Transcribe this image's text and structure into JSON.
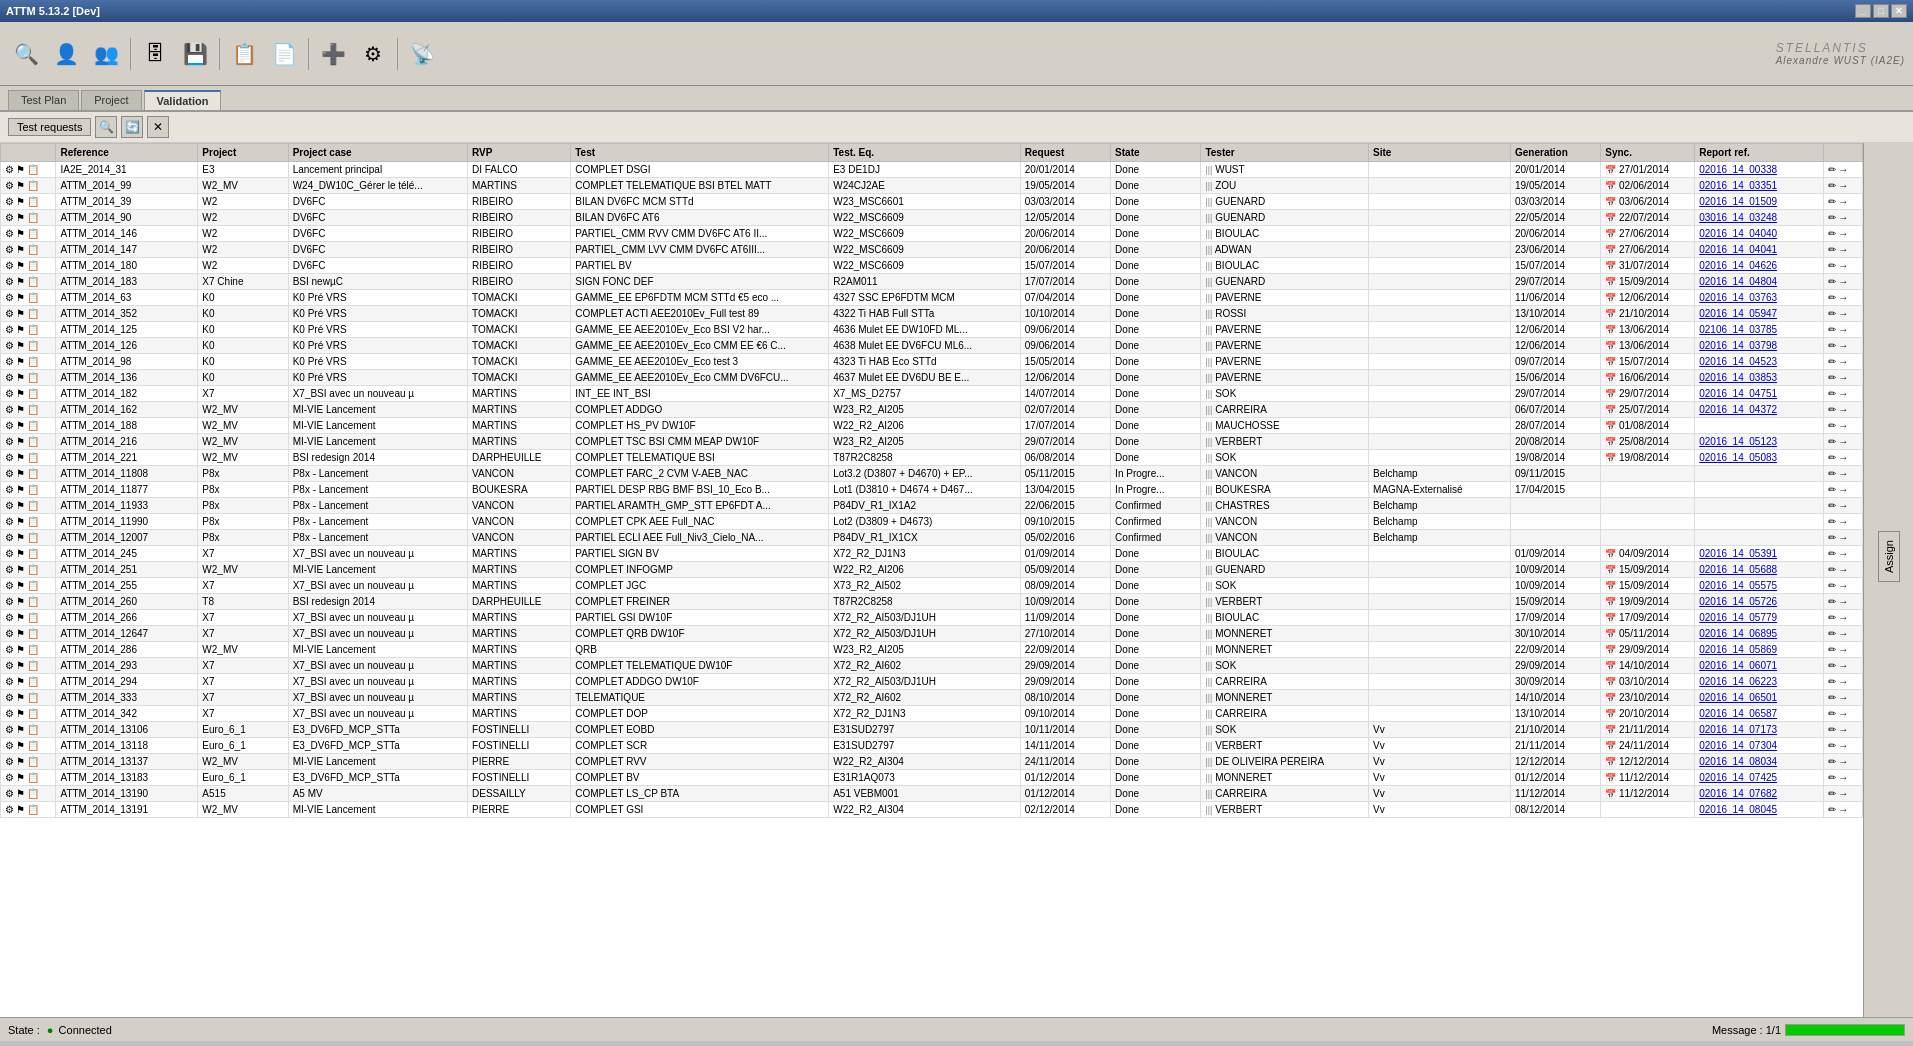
{
  "titleBar": {
    "title": "ATTM 5.13.2 [Dev]",
    "controls": [
      "_",
      "□",
      "✕"
    ]
  },
  "brand": "STELLANTIS",
  "userInfo": "Alexandre WUST (IA2E)",
  "tabs": [
    {
      "label": "Test Plan",
      "active": false
    },
    {
      "label": "Project",
      "active": false
    },
    {
      "label": "Validation",
      "active": true
    }
  ],
  "subToolbar": {
    "testRequestsBtn": "Test requests",
    "icons": [
      "🔍",
      "🔄",
      "✕"
    ]
  },
  "tableHeaders": [
    "Reference",
    "Project",
    "Project case",
    "RVP",
    "Test",
    "Test. Eq.",
    "Request",
    "State",
    "Tester",
    "Site",
    "Generation",
    "Sync.",
    "Report ref."
  ],
  "rows": [
    {
      "ref": "IA2E_2014_31",
      "icons": "⚙📋",
      "project": "E3",
      "case": "Lancement principal",
      "rvp": "DI FALCO",
      "test": "COMPLET DSGI",
      "testeq": "E3 DE1DJ",
      "request": "20/01/2014",
      "state": "Done",
      "tester": "WUST",
      "site": "",
      "gen": "20/01/2014",
      "sync": "27/01/2014",
      "report": "02016_14_00338"
    },
    {
      "ref": "ATTM_2014_99",
      "icons": "⚙📋",
      "project": "W2_MV",
      "case": "W24_DW10C_Gérer le télé...",
      "rvp": "MARTINS",
      "test": "COMPLET TELEMATIQUE BSI BTEL MATT",
      "testeq": "W24CJ2AE",
      "request": "19/05/2014",
      "state": "Done",
      "tester": "ZOU",
      "site": "",
      "gen": "19/05/2014",
      "sync": "02/06/2014",
      "report": "02016_14_03351"
    },
    {
      "ref": "ATTM_2014_39",
      "icons": "⚙📋",
      "project": "W2",
      "case": "DV6FC",
      "rvp": "RIBEIRO",
      "test": "BILAN DV6FC MCM STTd",
      "testeq": "W23_MSC6601",
      "request": "03/03/2014",
      "state": "Done",
      "tester": "GUENARD",
      "site": "",
      "gen": "03/03/2014",
      "sync": "03/06/2014",
      "report": "02016_14_01509"
    },
    {
      "ref": "ATTM_2014_90",
      "icons": "⚙📋",
      "project": "W2",
      "case": "DV6FC",
      "rvp": "RIBEIRO",
      "test": "BILAN DV6FC AT6",
      "testeq": "W22_MSC6609",
      "request": "12/05/2014",
      "state": "Done",
      "tester": "GUENARD",
      "site": "",
      "gen": "22/05/2014",
      "sync": "22/07/2014",
      "report": "03016_14_03248"
    },
    {
      "ref": "ATTM_2014_146",
      "icons": "⚙📋",
      "project": "W2",
      "case": "DV6FC",
      "rvp": "RIBEIRO",
      "test": "PARTIEL_CMM RVV CMM DV6FC AT6 II...",
      "testeq": "W22_MSC6609",
      "request": "20/06/2014",
      "state": "Done",
      "tester": "BIOULAC",
      "site": "",
      "gen": "20/06/2014",
      "sync": "27/06/2014",
      "report": "02016_14_04040"
    },
    {
      "ref": "ATTM_2014_147",
      "icons": "⚙📋",
      "project": "W2",
      "case": "DV6FC",
      "rvp": "RIBEIRO",
      "test": "PARTIEL_CMM LVV CMM DV6FC AT6III...",
      "testeq": "W22_MSC6609",
      "request": "20/06/2014",
      "state": "Done",
      "tester": "ADWAN",
      "site": "",
      "gen": "23/06/2014",
      "sync": "27/06/2014",
      "report": "02016_14_04041"
    },
    {
      "ref": "ATTM_2014_180",
      "icons": "⚙📋",
      "project": "W2",
      "case": "DV6FC",
      "rvp": "RIBEIRO",
      "test": "PARTIEL BV",
      "testeq": "W22_MSC6609",
      "request": "15/07/2014",
      "state": "Done",
      "tester": "BIOULAC",
      "site": "",
      "gen": "15/07/2014",
      "sync": "31/07/2014",
      "report": "02016_14_04626"
    },
    {
      "ref": "ATTM_2014_183",
      "icons": "⚙📋",
      "project": "X7 Chine",
      "case": "BSI newµC",
      "rvp": "RIBEIRO",
      "test": "SIGN FONC DEF",
      "testeq": "R2AM011",
      "request": "17/07/2014",
      "state": "Done",
      "tester": "GUENARD",
      "site": "",
      "gen": "29/07/2014",
      "sync": "15/09/2014",
      "report": "02016_14_04804"
    },
    {
      "ref": "ATTM_2014_63",
      "icons": "⚙📋",
      "project": "K0",
      "case": "K0 Pré VRS",
      "rvp": "TOMACKI",
      "test": "GAMME_EE EP6FDTM MCM STTd €5 eco ...",
      "testeq": "4327 SSC EP6FDTM MCM",
      "request": "07/04/2014",
      "state": "Done",
      "tester": "PAVERNE",
      "site": "",
      "gen": "11/06/2014",
      "sync": "12/06/2014",
      "report": "02016_14_03763"
    },
    {
      "ref": "ATTM_2014_352",
      "icons": "⚙📋",
      "project": "K0",
      "case": "K0 Pré VRS",
      "rvp": "TOMACKI",
      "test": "COMPLET ACTI AEE2010Ev_Full test 89",
      "testeq": "4322 Ti HAB Full STTa",
      "request": "10/10/2014",
      "state": "Done",
      "tester": "ROSSI",
      "site": "",
      "gen": "13/10/2014",
      "sync": "21/10/2014",
      "report": "02016_14_05947"
    },
    {
      "ref": "ATTM_2014_125",
      "icons": "⚙📋",
      "project": "K0",
      "case": "K0 Pré VRS",
      "rvp": "TOMACKI",
      "test": "GAMME_EE AEE2010Ev_Eco BSI V2 har...",
      "testeq": "4636 Mulet EE DW10FD ML...",
      "request": "09/06/2014",
      "state": "Done",
      "tester": "PAVERNE",
      "site": "",
      "gen": "12/06/2014",
      "sync": "13/06/2014",
      "report": "02106_14_03785"
    },
    {
      "ref": "ATTM_2014_126",
      "icons": "⚙📋",
      "project": "K0",
      "case": "K0 Pré VRS",
      "rvp": "TOMACKI",
      "test": "GAMME_EE AEE2010Ev_Eco CMM EE €6 C...",
      "testeq": "4638 Mulet EE DV6FCU ML6...",
      "request": "09/06/2014",
      "state": "Done",
      "tester": "PAVERNE",
      "site": "",
      "gen": "12/06/2014",
      "sync": "13/06/2014",
      "report": "02016_14_03798"
    },
    {
      "ref": "ATTM_2014_98",
      "icons": "⚙📋",
      "project": "K0",
      "case": "K0 Pré VRS",
      "rvp": "TOMACKI",
      "test": "GAMME_EE AEE2010Ev_Eco test 3",
      "testeq": "4323 Ti HAB Eco STTd",
      "request": "15/05/2014",
      "state": "Done",
      "tester": "PAVERNE",
      "site": "",
      "gen": "09/07/2014",
      "sync": "15/07/2014",
      "report": "02016_14_04523"
    },
    {
      "ref": "ATTM_2014_136",
      "icons": "⚙📋",
      "project": "K0",
      "case": "K0 Pré VRS",
      "rvp": "TOMACKI",
      "test": "GAMME_EE AEE2010Ev_Eco CMM DV6FCU...",
      "testeq": "4637 Mulet EE DV6DU BE E...",
      "request": "12/06/2014",
      "state": "Done",
      "tester": "PAVERNE",
      "site": "",
      "gen": "15/06/2014",
      "sync": "16/06/2014",
      "report": "02016_14_03853"
    },
    {
      "ref": "ATTM_2014_182",
      "icons": "⚙📋",
      "project": "X7",
      "case": "X7_BSI avec un nouveau µ",
      "rvp": "MARTINS",
      "test": "INT_EE INT_BSI",
      "testeq": "X7_MS_D2757",
      "request": "14/07/2014",
      "state": "Done",
      "tester": "SOK",
      "site": "",
      "gen": "29/07/2014",
      "sync": "29/07/2014",
      "report": "02016_14_04751"
    },
    {
      "ref": "ATTM_2014_162",
      "icons": "⚙📋",
      "project": "W2_MV",
      "case": "MI-VIE Lancement",
      "rvp": "MARTINS",
      "test": "COMPLET ADDGO",
      "testeq": "W23_R2_AI205",
      "request": "02/07/2014",
      "state": "Done",
      "tester": "CARREIRA",
      "site": "",
      "gen": "06/07/2014",
      "sync": "25/07/2014",
      "report": "02016_14_04372"
    },
    {
      "ref": "ATTM_2014_188",
      "icons": "⚙📋",
      "project": "W2_MV",
      "case": "MI-VIE Lancement",
      "rvp": "MARTINS",
      "test": "COMPLET HS_PV DW10F",
      "testeq": "W22_R2_AI206",
      "request": "17/07/2014",
      "state": "Done",
      "tester": "MAUCHOSSE",
      "site": "",
      "gen": "28/07/2014",
      "sync": "01/08/2014",
      "report": ""
    },
    {
      "ref": "ATTM_2014_216",
      "icons": "⚙📋",
      "project": "W2_MV",
      "case": "MI-VIE Lancement",
      "rvp": "MARTINS",
      "test": "COMPLET TSC BSI CMM MEAP DW10F",
      "testeq": "W23_R2_AI205",
      "request": "29/07/2014",
      "state": "Done",
      "tester": "VERBERT",
      "site": "",
      "gen": "20/08/2014",
      "sync": "25/08/2014",
      "report": "02016_14_05123"
    },
    {
      "ref": "ATTM_2014_221",
      "icons": "⚙📋",
      "project": "W2_MV",
      "case": "BSI redesign 2014",
      "rvp": "DARPHEUILLE",
      "test": "COMPLET TELEMATIQUE BSI",
      "testeq": "T87R2C8258",
      "request": "06/08/2014",
      "state": "Done",
      "tester": "SOK",
      "site": "",
      "gen": "19/08/2014",
      "sync": "19/08/2014",
      "report": "02016_14_05083"
    },
    {
      "ref": "ATTM_2014_11808",
      "icons": "⚙📋",
      "project": "P8x",
      "case": "P8x - Lancement",
      "rvp": "VANCON",
      "test": "COMPLET FARC_2 CVM V-AEB_NAC",
      "testeq": "Lot3.2 (D3807 + D4670) + EP...",
      "request": "05/11/2015",
      "state": "In Progre...",
      "tester": "VANCON",
      "site": "Belchamp",
      "gen": "09/11/2015",
      "sync": "",
      "report": ""
    },
    {
      "ref": "ATTM_2014_11877",
      "icons": "⚙📋",
      "project": "P8x",
      "case": "P8x - Lancement",
      "rvp": "BOUKESRA",
      "test": "PARTIEL DESP RBG BMF BSI_10_Eco B...",
      "testeq": "Lot1 (D3810 + D4674 + D467...",
      "request": "13/04/2015",
      "state": "In Progre...",
      "tester": "BOUKESRA",
      "site": "MAGNA-Externalisé",
      "gen": "17/04/2015",
      "sync": "",
      "report": ""
    },
    {
      "ref": "ATTM_2014_11933",
      "icons": "⚙📋",
      "project": "P8x",
      "case": "P8x - Lancement",
      "rvp": "VANCON",
      "test": "PARTIEL ARAMTH_GMP_STT EP6FDT A...",
      "testeq": "P84DV_R1_IX1A2",
      "request": "22/06/2015",
      "state": "Confirmed",
      "tester": "CHASTRES",
      "site": "Belchamp",
      "gen": "",
      "sync": "",
      "report": ""
    },
    {
      "ref": "ATTM_2014_11990",
      "icons": "⚙📋",
      "project": "P8x",
      "case": "P8x - Lancement",
      "rvp": "VANCON",
      "test": "COMPLET CPK AEE Full_NAC",
      "testeq": "Lot2 (D3809 + D4673)",
      "request": "09/10/2015",
      "state": "Confirmed",
      "tester": "VANCON",
      "site": "Belchamp",
      "gen": "",
      "sync": "",
      "report": ""
    },
    {
      "ref": "ATTM_2014_12007",
      "icons": "⚙📋",
      "project": "P8x",
      "case": "P8x - Lancement",
      "rvp": "VANCON",
      "test": "PARTIEL ECLI AEE Full_Niv3_Cielo_NA...",
      "testeq": "P84DV_R1_IX1CX",
      "request": "05/02/2016",
      "state": "Confirmed",
      "tester": "VANCON",
      "site": "Belchamp",
      "gen": "",
      "sync": "",
      "report": ""
    },
    {
      "ref": "ATTM_2014_245",
      "icons": "⚙📋",
      "project": "X7",
      "case": "X7_BSI avec un nouveau µ",
      "rvp": "MARTINS",
      "test": "PARTIEL SIGN BV",
      "testeq": "X72_R2_DJ1N3",
      "request": "01/09/2014",
      "state": "Done",
      "tester": "BIOULAC",
      "site": "",
      "gen": "01/09/2014",
      "sync": "04/09/2014",
      "report": "02016_14_05391"
    },
    {
      "ref": "ATTM_2014_251",
      "icons": "⚙📋",
      "project": "W2_MV",
      "case": "MI-VIE Lancement",
      "rvp": "MARTINS",
      "test": "COMPLET INFOGMP",
      "testeq": "W22_R2_AI206",
      "request": "05/09/2014",
      "state": "Done",
      "tester": "GUENARD",
      "site": "",
      "gen": "10/09/2014",
      "sync": "15/09/2014",
      "report": "02016_14_05688"
    },
    {
      "ref": "ATTM_2014_255",
      "icons": "⚙📋",
      "project": "X7",
      "case": "X7_BSI avec un nouveau µ",
      "rvp": "MARTINS",
      "test": "COMPLET JGC",
      "testeq": "X73_R2_AI502",
      "request": "08/09/2014",
      "state": "Done",
      "tester": "SOK",
      "site": "",
      "gen": "10/09/2014",
      "sync": "15/09/2014",
      "report": "02016_14_05575"
    },
    {
      "ref": "ATTM_2014_260",
      "icons": "⚙📋",
      "project": "T8",
      "case": "BSI redesign 2014",
      "rvp": "DARPHEUILLE",
      "test": "COMPLET FREINER",
      "testeq": "T87R2C8258",
      "request": "10/09/2014",
      "state": "Done",
      "tester": "VERBERT",
      "site": "",
      "gen": "15/09/2014",
      "sync": "19/09/2014",
      "report": "02016_14_05726"
    },
    {
      "ref": "ATTM_2014_266",
      "icons": "⚙📋",
      "project": "X7",
      "case": "X7_BSI avec un nouveau µ",
      "rvp": "MARTINS",
      "test": "PARTIEL GSI DW10F",
      "testeq": "X72_R2_AI503/DJ1UH",
      "request": "11/09/2014",
      "state": "Done",
      "tester": "BIOULAC",
      "site": "",
      "gen": "17/09/2014",
      "sync": "17/09/2014",
      "report": "02016_14_05779"
    },
    {
      "ref": "ATTM_2014_12647",
      "icons": "⚙📋",
      "project": "X7",
      "case": "X7_BSI avec un nouveau µ",
      "rvp": "MARTINS",
      "test": "COMPLET QRB DW10F",
      "testeq": "X72_R2_AI503/DJ1UH",
      "request": "27/10/2014",
      "state": "Done",
      "tester": "MONNERET",
      "site": "",
      "gen": "30/10/2014",
      "sync": "05/11/2014",
      "report": "02016_14_06895"
    },
    {
      "ref": "ATTM_2014_286",
      "icons": "⚙📋",
      "project": "W2_MV",
      "case": "MI-VIE Lancement",
      "rvp": "MARTINS",
      "test": "QRB",
      "testeq": "W23_R2_AI205",
      "request": "22/09/2014",
      "state": "Done",
      "tester": "MONNERET",
      "site": "",
      "gen": "22/09/2014",
      "sync": "29/09/2014",
      "report": "02016_14_05869"
    },
    {
      "ref": "ATTM_2014_293",
      "icons": "⚙📋",
      "project": "X7",
      "case": "X7_BSI avec un nouveau µ",
      "rvp": "MARTINS",
      "test": "COMPLET TELEMATIQUE DW10F",
      "testeq": "X72_R2_AI602",
      "request": "29/09/2014",
      "state": "Done",
      "tester": "SOK",
      "site": "",
      "gen": "29/09/2014",
      "sync": "14/10/2014",
      "report": "02016_14_06071"
    },
    {
      "ref": "ATTM_2014_294",
      "icons": "⚙📋",
      "project": "X7",
      "case": "X7_BSI avec un nouveau µ",
      "rvp": "MARTINS",
      "test": "COMPLET ADDGO DW10F",
      "testeq": "X72_R2_AI503/DJ1UH",
      "request": "29/09/2014",
      "state": "Done",
      "tester": "CARREIRA",
      "site": "",
      "gen": "30/09/2014",
      "sync": "03/10/2014",
      "report": "02016_14_06223"
    },
    {
      "ref": "ATTM_2014_333",
      "icons": "⚙📋",
      "project": "X7",
      "case": "X7_BSI avec un nouveau µ",
      "rvp": "MARTINS",
      "test": "TELEMATIQUE",
      "testeq": "X72_R2_AI602",
      "request": "08/10/2014",
      "state": "Done",
      "tester": "MONNERET",
      "site": "",
      "gen": "14/10/2014",
      "sync": "23/10/2014",
      "report": "02016_14_06501"
    },
    {
      "ref": "ATTM_2014_342",
      "icons": "⚙📋",
      "project": "X7",
      "case": "X7_BSI avec un nouveau µ",
      "rvp": "MARTINS",
      "test": "COMPLET DOP",
      "testeq": "X72_R2_DJ1N3",
      "request": "09/10/2014",
      "state": "Done",
      "tester": "CARREIRA",
      "site": "",
      "gen": "13/10/2014",
      "sync": "20/10/2014",
      "report": "02016_14_06587"
    },
    {
      "ref": "ATTM_2014_13106",
      "icons": "⚙📋",
      "project": "Euro_6_1",
      "case": "E3_DV6FD_MCP_STTa",
      "rvp": "FOSTINELLI",
      "test": "COMPLET EOBD",
      "testeq": "E31SUD2797",
      "request": "10/11/2014",
      "state": "Done",
      "tester": "SOK",
      "site": "Vv",
      "gen": "21/10/2014",
      "sync": "21/11/2014",
      "report": "02016_14_07173"
    },
    {
      "ref": "ATTM_2014_13118",
      "icons": "⚙📋",
      "project": "Euro_6_1",
      "case": "E3_DV6FD_MCP_STTa",
      "rvp": "FOSTINELLI",
      "test": "COMPLET SCR",
      "testeq": "E31SUD2797",
      "request": "14/11/2014",
      "state": "Done",
      "tester": "VERBERT",
      "site": "Vv",
      "gen": "21/11/2014",
      "sync": "24/11/2014",
      "report": "02016_14_07304"
    },
    {
      "ref": "ATTM_2014_13137",
      "icons": "⚙📋",
      "project": "W2_MV",
      "case": "MI-VIE Lancement",
      "rvp": "PIERRE",
      "test": "COMPLET RVV",
      "testeq": "W22_R2_AI304",
      "request": "24/11/2014",
      "state": "Done",
      "tester": "DE OLIVEIRA PEREIRA",
      "site": "Vv",
      "gen": "12/12/2014",
      "sync": "12/12/2014",
      "report": "02016_14_08034"
    },
    {
      "ref": "ATTM_2014_13183",
      "icons": "⚙📋",
      "project": "Euro_6_1",
      "case": "E3_DV6FD_MCP_STTa",
      "rvp": "FOSTINELLI",
      "test": "COMPLET BV",
      "testeq": "E31R1AQ073",
      "request": "01/12/2014",
      "state": "Done",
      "tester": "MONNERET",
      "site": "Vv",
      "gen": "01/12/2014",
      "sync": "11/12/2014",
      "report": "02016_14_07425"
    },
    {
      "ref": "ATTM_2014_13190",
      "icons": "⚙📋",
      "project": "A515",
      "case": "A5 MV",
      "rvp": "DESSAILLY",
      "test": "COMPLET LS_CP BTA",
      "testeq": "A51 VEBM001",
      "request": "01/12/2014",
      "state": "Done",
      "tester": "CARREIRA",
      "site": "Vv",
      "gen": "11/12/2014",
      "sync": "11/12/2014",
      "report": "02016_14_07682"
    },
    {
      "ref": "ATTM_2014_13191",
      "icons": "⚙📋",
      "project": "W2_MV",
      "case": "MI-VIE Lancement",
      "rvp": "PIERRE",
      "test": "COMPLET GSI",
      "testeq": "W22_R2_AI304",
      "request": "02/12/2014",
      "state": "Done",
      "tester": "VERBERT",
      "site": "Vv",
      "gen": "08/12/2014",
      "sync": "",
      "report": "02016_14_08045"
    }
  ],
  "statusBar": {
    "state": "State :",
    "connected": "Connected",
    "message": "Message : 1/1",
    "progressPercent": 100
  },
  "rightPanel": {
    "assignLabel": "Assign"
  }
}
